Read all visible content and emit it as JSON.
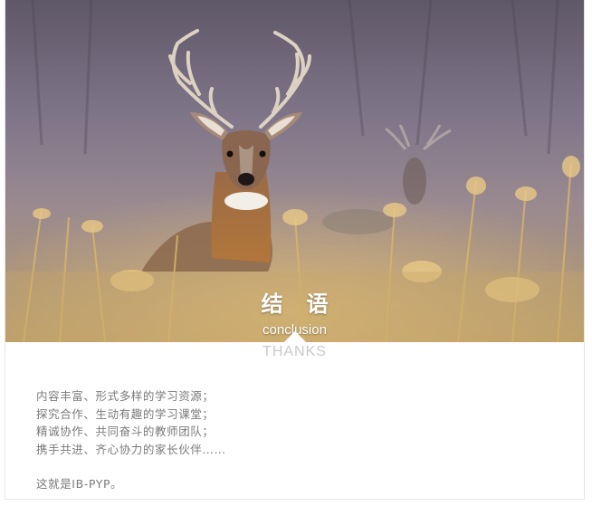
{
  "title": "结语",
  "subtitle": "conclusion",
  "thanks": "THANKS",
  "lines": [
    "内容丰富、形式多样的学习资源；",
    "探究合作、生动有趣的学习课堂；",
    "精诚协作、共同奋斗的教师团队；",
    "携手共进、齐心协力的家长伙伴……"
  ],
  "closing": "这就是IB-PYP。",
  "colors": {
    "text": "#7a7a7a",
    "thanks": "#c9c9c9"
  }
}
